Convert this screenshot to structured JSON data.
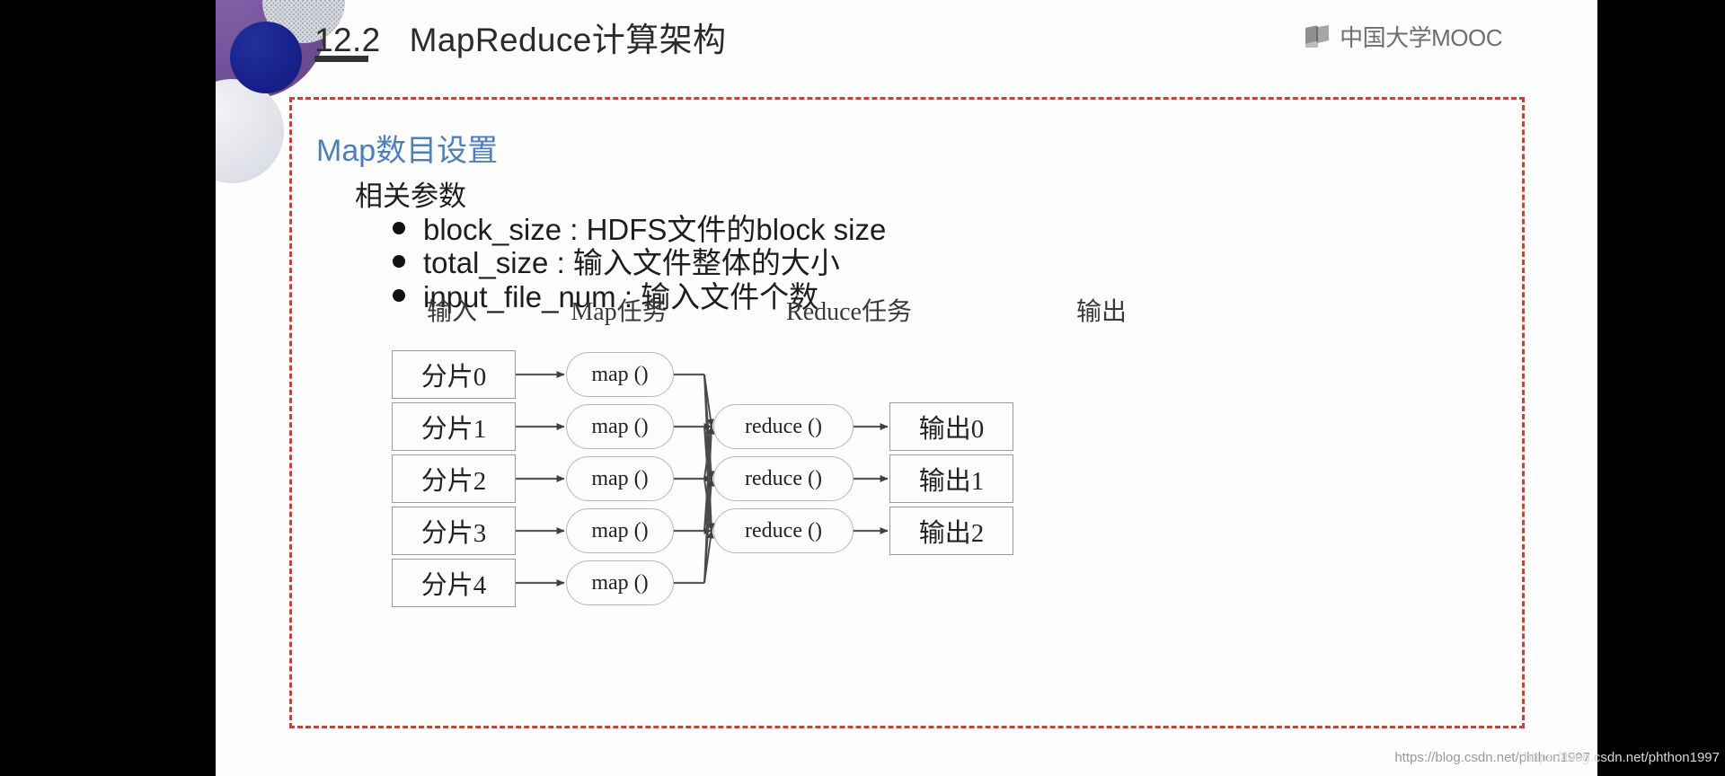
{
  "header": {
    "title_number": "12.2",
    "title_text": "MapReduce计算架构",
    "logo_text": "中国大学MOOC",
    "logo_icon": "book-icon"
  },
  "content": {
    "section_heading": "Map数目设置",
    "subheading": "相关参数",
    "bullets": [
      "block_size : HDFS文件的block size",
      "total_size : 输入文件整体的大小",
      "input_file_num : 输入文件个数"
    ]
  },
  "diagram": {
    "column_headers": [
      "输入",
      "Map任务",
      "Reduce任务",
      "输出"
    ],
    "input_nodes": [
      "分片0",
      "分片1",
      "分片2",
      "分片3",
      "分片4"
    ],
    "map_nodes": [
      "map ()",
      "map ()",
      "map ()",
      "map ()",
      "map ()"
    ],
    "reduce_nodes": [
      "reduce ()",
      "reduce ()",
      "reduce ()"
    ],
    "output_nodes": [
      "输出0",
      "输出1",
      "输出2"
    ]
  },
  "watermark": {
    "url": "https://blog.csdn.net/phthon1997"
  },
  "colors": {
    "heading_blue": "#4d7fbd",
    "frame_red": "#b9493c",
    "deco_purple": "#6f4f97",
    "deco_navy": "#161f86",
    "node_border": "#9a9a9a",
    "arrow": "#4a4a4a"
  }
}
